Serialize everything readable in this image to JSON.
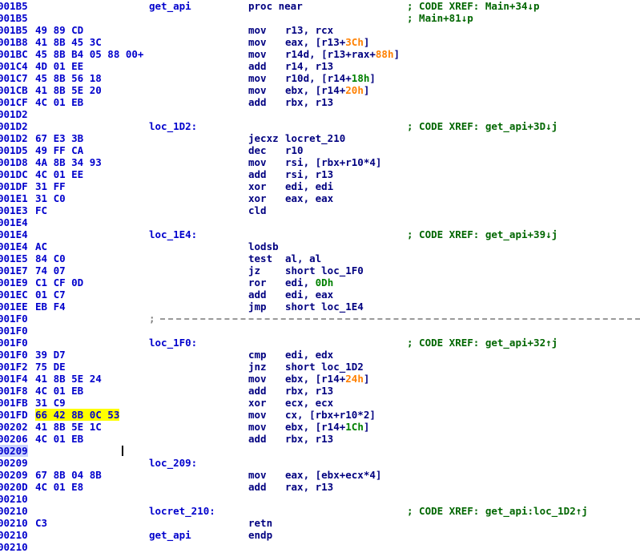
{
  "view": {
    "name": "IDA Pro disassembly listing",
    "background_color": "#ffffff",
    "address_color": "#0000cc",
    "bytes_color": "#0000cc",
    "mnemonic_color": "#000080",
    "label_color": "#0000cc",
    "comment_color": "#006600",
    "constant_orange": "#ff8000",
    "constant_green": "#008000",
    "highlight_color": "#ffff00",
    "separator_color": "#9a9a9a"
  },
  "function": {
    "name": "get_api",
    "proc_keyword": "proc near",
    "endp_keyword": "endp"
  },
  "lines": [
    {
      "addr": "001B5",
      "bytes": "",
      "label": "get_api",
      "mnem": "",
      "ops": "",
      "proc": "proc near",
      "comment": "; CODE XREF: Main+34↓p"
    },
    {
      "addr": "001B5",
      "bytes": "",
      "label": "",
      "mnem": "",
      "ops": "",
      "comment": "; Main+81↓p"
    },
    {
      "addr": "001B5",
      "bytes": "49 89 CD",
      "label": "",
      "mnem": "mov",
      "ops": "r13, rcx",
      "comment": ""
    },
    {
      "addr": "001B8",
      "bytes": "41 8B 45 3C",
      "label": "",
      "mnem": "mov",
      "ops_pre": "eax, [r13+",
      "ops_const": "3Ch",
      "ops_const_color": "orange",
      "ops_post": "]",
      "comment": ""
    },
    {
      "addr": "001BC",
      "bytes": "45 8B B4 05 88 00+",
      "label": "",
      "mnem": "mov",
      "ops_pre": "r14d, [r13+rax+",
      "ops_const": "88h",
      "ops_const_color": "orange",
      "ops_post": "]",
      "comment": ""
    },
    {
      "addr": "001C4",
      "bytes": "4D 01 EE",
      "label": "",
      "mnem": "add",
      "ops": "r14, r13",
      "comment": ""
    },
    {
      "addr": "001C7",
      "bytes": "45 8B 56 18",
      "label": "",
      "mnem": "mov",
      "ops_pre": "r10d, [r14+",
      "ops_const": "18h",
      "ops_const_color": "dkgreen",
      "ops_post": "]",
      "comment": ""
    },
    {
      "addr": "001CB",
      "bytes": "41 8B 5E 20",
      "label": "",
      "mnem": "mov",
      "ops_pre": "ebx, [r14+",
      "ops_const": "20h",
      "ops_const_color": "orange",
      "ops_post": "]",
      "comment": ""
    },
    {
      "addr": "001CF",
      "bytes": "4C 01 EB",
      "label": "",
      "mnem": "add",
      "ops": "rbx, r13",
      "comment": ""
    },
    {
      "addr": "001D2",
      "bytes": "",
      "label": "",
      "mnem": "",
      "ops": "",
      "comment": ""
    },
    {
      "addr": "001D2",
      "bytes": "",
      "label": "loc_1D2:",
      "mnem": "",
      "ops": "",
      "comment": "; CODE XREF: get_api+3D↓j"
    },
    {
      "addr": "001D2",
      "bytes": "67 E3 3B",
      "label": "",
      "mnem": "jecxz",
      "ops": "locret_210",
      "comment": ""
    },
    {
      "addr": "001D5",
      "bytes": "49 FF CA",
      "label": "",
      "mnem": "dec",
      "ops": "r10",
      "comment": ""
    },
    {
      "addr": "001D8",
      "bytes": "4A 8B 34 93",
      "label": "",
      "mnem": "mov",
      "ops": "rsi, [rbx+r10*4]",
      "comment": ""
    },
    {
      "addr": "001DC",
      "bytes": "4C 01 EE",
      "label": "",
      "mnem": "add",
      "ops": "rsi, r13",
      "comment": ""
    },
    {
      "addr": "001DF",
      "bytes": "31 FF",
      "label": "",
      "mnem": "xor",
      "ops": "edi, edi",
      "comment": ""
    },
    {
      "addr": "001E1",
      "bytes": "31 C0",
      "label": "",
      "mnem": "xor",
      "ops": "eax, eax",
      "comment": ""
    },
    {
      "addr": "001E3",
      "bytes": "FC",
      "label": "",
      "mnem": "cld",
      "ops": "",
      "comment": ""
    },
    {
      "addr": "001E4",
      "bytes": "",
      "label": "",
      "mnem": "",
      "ops": "",
      "comment": ""
    },
    {
      "addr": "001E4",
      "bytes": "",
      "label": "loc_1E4:",
      "mnem": "",
      "ops": "",
      "comment": "; CODE XREF: get_api+39↓j"
    },
    {
      "addr": "001E4",
      "bytes": "AC",
      "label": "",
      "mnem": "lodsb",
      "ops": "",
      "comment": ""
    },
    {
      "addr": "001E5",
      "bytes": "84 C0",
      "label": "",
      "mnem": "test",
      "ops": "al, al",
      "comment": ""
    },
    {
      "addr": "001E7",
      "bytes": "74 07",
      "label": "",
      "mnem": "jz",
      "ops": "short loc_1F0",
      "comment": ""
    },
    {
      "addr": "001E9",
      "bytes": "C1 CF 0D",
      "label": "",
      "mnem": "ror",
      "ops_pre": "edi, ",
      "ops_const": "0Dh",
      "ops_const_color": "dkgreen",
      "ops_post": "",
      "comment": ""
    },
    {
      "addr": "001EC",
      "bytes": "01 C7",
      "label": "",
      "mnem": "add",
      "ops": "edi, eax",
      "comment": ""
    },
    {
      "addr": "001EE",
      "bytes": "EB F4",
      "label": "",
      "mnem": "jmp",
      "ops": "short loc_1E4",
      "comment": ""
    },
    {
      "addr": "001F0",
      "bytes": "",
      "label": "",
      "mnem": "",
      "ops": "",
      "comment": "",
      "separator": true
    },
    {
      "addr": "001F0",
      "bytes": "",
      "label": "",
      "mnem": "",
      "ops": "",
      "comment": ""
    },
    {
      "addr": "001F0",
      "bytes": "",
      "label": "loc_1F0:",
      "mnem": "",
      "ops": "",
      "comment": "; CODE XREF: get_api+32↑j"
    },
    {
      "addr": "001F0",
      "bytes": "39 D7",
      "label": "",
      "mnem": "cmp",
      "ops": "edi, edx",
      "comment": ""
    },
    {
      "addr": "001F2",
      "bytes": "75 DE",
      "label": "",
      "mnem": "jnz",
      "ops": "short loc_1D2",
      "comment": ""
    },
    {
      "addr": "001F4",
      "bytes": "41 8B 5E 24",
      "label": "",
      "mnem": "mov",
      "ops_pre": "ebx, [r14+",
      "ops_const": "24h",
      "ops_const_color": "orange",
      "ops_post": "]",
      "comment": ""
    },
    {
      "addr": "001F8",
      "bytes": "4C 01 EB",
      "label": "",
      "mnem": "add",
      "ops": "rbx, r13",
      "comment": ""
    },
    {
      "addr": "001FB",
      "bytes": "31 C9",
      "label": "",
      "mnem": "xor",
      "ops": "ecx, ecx",
      "comment": ""
    },
    {
      "addr": "001FD",
      "bytes": "66 42 8B 0C 53",
      "bytes_highlight": true,
      "label": "",
      "mnem": "mov",
      "ops": "cx, [rbx+r10*2]",
      "comment": ""
    },
    {
      "addr": "00202",
      "bytes": "41 8B 5E 1C",
      "label": "",
      "mnem": "mov",
      "ops_pre": "ebx, [r14+",
      "ops_const": "1Ch",
      "ops_const_color": "dkgreen",
      "ops_post": "]",
      "comment": ""
    },
    {
      "addr": "00206",
      "bytes": "4C 01 EB",
      "label": "",
      "mnem": "add",
      "ops": "rbx, r13",
      "comment": ""
    },
    {
      "addr": "00209",
      "bytes": "",
      "label": "",
      "mnem": "",
      "ops": "",
      "comment": "",
      "addr_highlight": true,
      "caret": true
    },
    {
      "addr": "00209",
      "bytes": "",
      "label": "loc_209:",
      "mnem": "",
      "ops": "",
      "comment": ""
    },
    {
      "addr": "00209",
      "bytes": "67 8B 04 8B",
      "label": "",
      "mnem": "mov",
      "ops": "eax, [ebx+ecx*4]",
      "comment": ""
    },
    {
      "addr": "0020D",
      "bytes": "4C 01 E8",
      "label": "",
      "mnem": "add",
      "ops": "rax, r13",
      "comment": ""
    },
    {
      "addr": "00210",
      "bytes": "",
      "label": "",
      "mnem": "",
      "ops": "",
      "comment": ""
    },
    {
      "addr": "00210",
      "bytes": "",
      "label": "locret_210:",
      "mnem": "",
      "ops": "",
      "comment": "; CODE XREF: get_api:loc_1D2↑j"
    },
    {
      "addr": "00210",
      "bytes": "C3",
      "label": "",
      "mnem": "retn",
      "ops": "",
      "comment": ""
    },
    {
      "addr": "00210",
      "bytes": "",
      "label": "get_api",
      "mnem": "endp",
      "ops": "",
      "comment": ""
    },
    {
      "addr": "00210",
      "bytes": "",
      "label": "",
      "mnem": "",
      "ops": "",
      "comment": ""
    }
  ]
}
